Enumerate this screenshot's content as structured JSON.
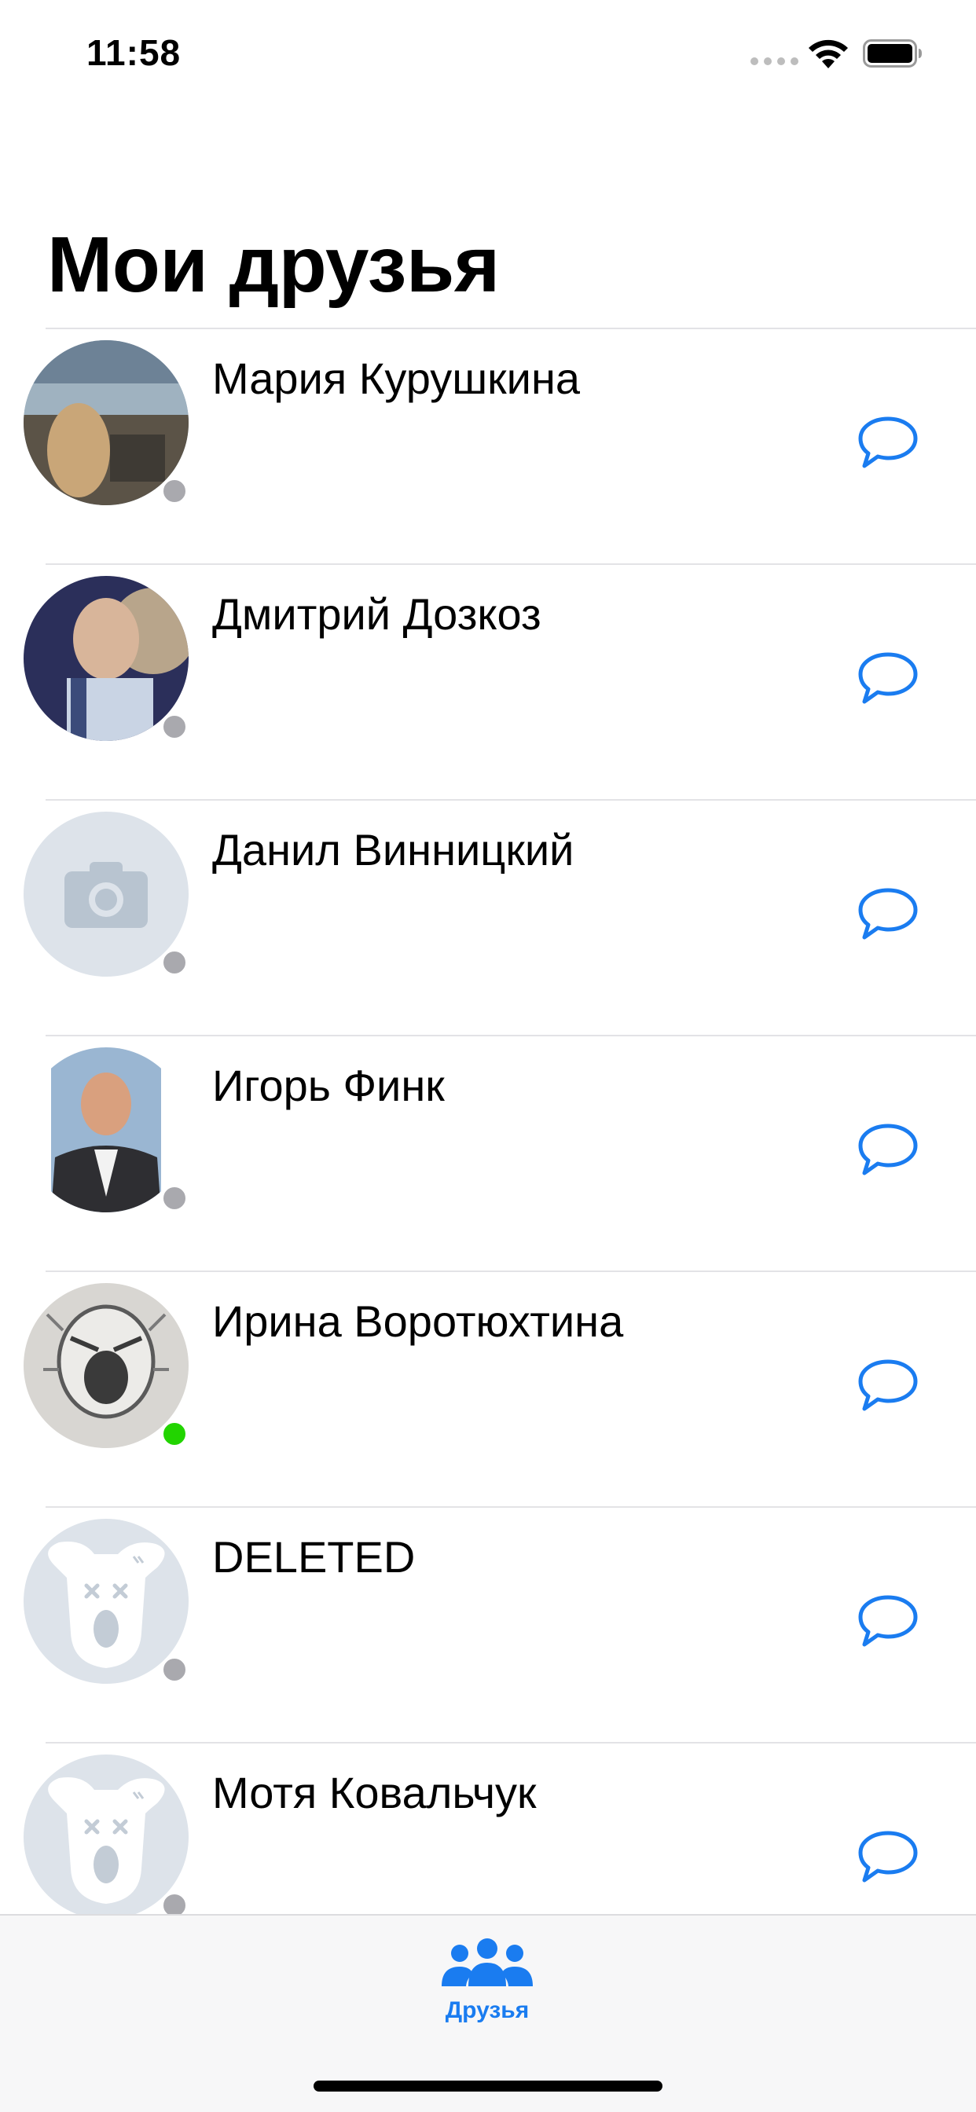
{
  "status_bar": {
    "time": "11:58",
    "icons": [
      "signal-icon",
      "wifi-icon",
      "battery-icon"
    ]
  },
  "page": {
    "title": "Мои друзья"
  },
  "friends": [
    {
      "name": "Мария Курушкина",
      "avatar": "photo",
      "online": false
    },
    {
      "name": "Дмитрий Дозкоз",
      "avatar": "photo",
      "online": false
    },
    {
      "name": "Данил Винницкий",
      "avatar": "camera-placeholder",
      "online": false
    },
    {
      "name": "Игорь Финк",
      "avatar": "photo",
      "online": false
    },
    {
      "name": "Ирина Воротюхтина",
      "avatar": "photo",
      "online": true
    },
    {
      "name": "DELETED",
      "avatar": "deleted-dog",
      "online": false
    },
    {
      "name": "Мотя Ковальчук",
      "avatar": "deleted-dog",
      "online": false
    }
  ],
  "tab_bar": {
    "tabs": [
      {
        "label": "Друзья",
        "icon": "people-icon",
        "active": true
      }
    ]
  },
  "colors": {
    "accent": "#1a7cf0",
    "online": "#22d400",
    "offline": "#a9a9ae",
    "separator": "#e3e3e6",
    "placeholder_bg": "#dde3ea",
    "placeholder_fg": "#b8c4d0"
  }
}
